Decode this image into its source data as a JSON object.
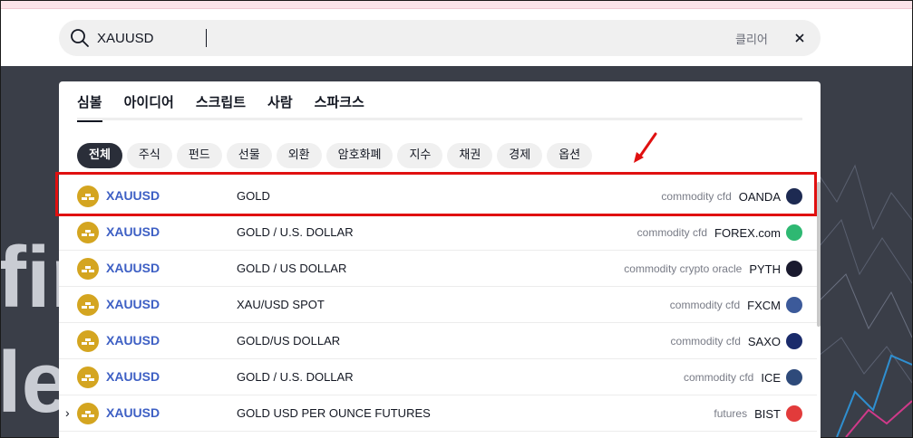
{
  "search": {
    "value": "XAUUSD",
    "clear_label": "클리어"
  },
  "main_tabs": [
    {
      "label": "심볼",
      "active": true
    },
    {
      "label": "아이디어",
      "active": false
    },
    {
      "label": "스크립트",
      "active": false
    },
    {
      "label": "사람",
      "active": false
    },
    {
      "label": "스파크스",
      "active": false
    }
  ],
  "filters": [
    {
      "label": "전체",
      "active": true
    },
    {
      "label": "주식",
      "active": false
    },
    {
      "label": "펀드",
      "active": false
    },
    {
      "label": "선물",
      "active": false
    },
    {
      "label": "외환",
      "active": false
    },
    {
      "label": "암호화폐",
      "active": false
    },
    {
      "label": "지수",
      "active": false
    },
    {
      "label": "채권",
      "active": false
    },
    {
      "label": "경제",
      "active": false
    },
    {
      "label": "옵션",
      "active": false
    }
  ],
  "results": [
    {
      "symbol": "XAUUSD",
      "description": "GOLD",
      "type": "commodity cfd",
      "exchange": "OANDA",
      "logo_color": "#1d2a52",
      "expand": ""
    },
    {
      "symbol": "XAUUSD",
      "description": "GOLD / U.S. DOLLAR",
      "type": "commodity cfd",
      "exchange": "FOREX.com",
      "logo_color": "#2eb872",
      "expand": ""
    },
    {
      "symbol": "XAUUSD",
      "description": "GOLD / US DOLLAR",
      "type": "commodity crypto oracle",
      "exchange": "PYTH",
      "logo_color": "#1a1a2e",
      "expand": ""
    },
    {
      "symbol": "XAUUSD",
      "description": "XAU/USD SPOT",
      "type": "commodity cfd",
      "exchange": "FXCM",
      "logo_color": "#3c5a9a",
      "expand": ""
    },
    {
      "symbol": "XAUUSD",
      "description": "GOLD/US DOLLAR",
      "type": "commodity cfd",
      "exchange": "SAXO",
      "logo_color": "#1a2b6b",
      "expand": ""
    },
    {
      "symbol": "XAUUSD",
      "description": "GOLD / U.S. DOLLAR",
      "type": "commodity cfd",
      "exchange": "ICE",
      "logo_color": "#2e4a7a",
      "expand": ""
    },
    {
      "symbol": "XAUUSD",
      "description": "GOLD USD PER OUNCE FUTURES",
      "type": "futures",
      "exchange": "BIST",
      "logo_color": "#e23b3b",
      "expand": "›"
    }
  ],
  "background_text": [
    "fir",
    "le"
  ],
  "colors": {
    "accent_symbol": "#3d5fc4",
    "highlight": "#e01010",
    "coin": "#d4a520"
  }
}
